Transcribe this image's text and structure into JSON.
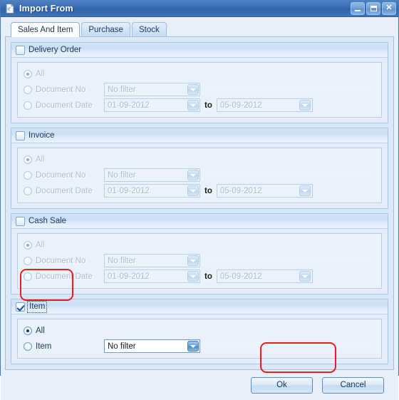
{
  "window": {
    "title": "Import From",
    "icon": "document-import-icon",
    "controls": {
      "minimize": "minimize-icon",
      "maximize": "maximize-icon",
      "close": "close-icon"
    }
  },
  "tabs": [
    {
      "label": "Sales And Item",
      "active": true
    },
    {
      "label": "Purchase",
      "active": false
    },
    {
      "label": "Stock",
      "active": false
    }
  ],
  "groups": [
    {
      "title": "Delivery Order",
      "checked": false,
      "enabled": false,
      "focused": false,
      "rows": {
        "all": "All",
        "doc_no": "Document No",
        "doc_no_value": "No filter",
        "doc_date": "Document Date",
        "date_from": "01-09-2012",
        "date_to_label": "to",
        "date_to": "05-09-2012"
      },
      "selected": "all"
    },
    {
      "title": "Invoice",
      "checked": false,
      "enabled": false,
      "focused": false,
      "rows": {
        "all": "All",
        "doc_no": "Document No",
        "doc_no_value": "No filter",
        "doc_date": "Document Date",
        "date_from": "01-09-2012",
        "date_to_label": "to",
        "date_to": "05-09-2012"
      },
      "selected": "all"
    },
    {
      "title": "Cash Sale",
      "checked": false,
      "enabled": false,
      "focused": false,
      "rows": {
        "all": "All",
        "doc_no": "Document No",
        "doc_no_value": "No filter",
        "doc_date": "Document Date",
        "date_from": "01-09-2012",
        "date_to_label": "to",
        "date_to": "05-09-2012"
      },
      "selected": "all"
    }
  ],
  "item_group": {
    "title": "Item",
    "checked": true,
    "enabled": true,
    "focused": true,
    "rows": {
      "all": "All",
      "item": "Item",
      "item_value": "No filter"
    },
    "selected": "all"
  },
  "buttons": {
    "ok": "Ok",
    "cancel": "Cancel"
  },
  "annotations": {
    "item_checkbox_highlight": "red-rect",
    "ok_button_highlight": "red-rect",
    "color": "#ee1c1c"
  }
}
